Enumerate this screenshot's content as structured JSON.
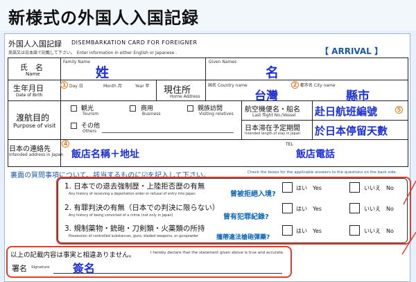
{
  "banner_title": "新様式の外国人入国記録",
  "header": {
    "card_title_ja": "外国人入国記録",
    "card_title_en": "DISEMBARKATION CARD FOR FOREIGNER",
    "instruction": "英語又は日本語で記載して下さい。　Enter information in either English or Japanese .",
    "arrival": "【 ARRIVAL 】"
  },
  "name_row": {
    "label_ja": "氏　名",
    "label_en": "Name",
    "family_label": "Family Name",
    "family_value": "姓",
    "given_label": "Given Names",
    "given_value": "名"
  },
  "dob_row": {
    "label_ja": "生年月日",
    "label_en": "Date of Birth",
    "marker": "1",
    "day": "Day 日",
    "month": "Month 月",
    "year": "Year 年",
    "address_ja": "現住所",
    "address_en": "Home Address",
    "country_label": "国名 Country name",
    "country_value": "台灣",
    "city_marker": "2",
    "city_label": "都市名 City name",
    "city_value": "縣市"
  },
  "purpose_row": {
    "label_ja": "渡航目的",
    "label_en": "Purpose of visit",
    "opt_tourism_ja": "観光",
    "opt_tourism_en": "Tourism",
    "opt_business_ja": "商用",
    "opt_business_en": "Business",
    "opt_visiting_ja": "親族訪問",
    "opt_visiting_en": "Visiting relatives",
    "opt_others_ja": "その他",
    "opt_others_en": "Others",
    "flight_label_ja": "航空機便名・船名",
    "flight_label_en": "Last flight No./Vessel",
    "flight_value": "赴日航班編號",
    "flight_marker": "5",
    "stay_label_ja": "日本滞在予定期間",
    "stay_label_en": "Intended length of stay in Japan",
    "stay_value": "於日本停留天數"
  },
  "contact_row": {
    "label_ja": "日本の連絡先",
    "label_en": "Intended address in Japan",
    "marker": "4",
    "hotel_value": "飯店名稱＋地址",
    "tel_label": "TEL",
    "tel_value": "飯店電話"
  },
  "questions_header": {
    "ja": "裏面の質問事項について、該当するものに☑を記入して下さい。",
    "en": "Check the boxes for the applicable answers to the questions on the back side."
  },
  "questions": [
    {
      "text_ja": "1. 日本での退去強制歴・上陸拒否歴の有無",
      "text_en": "Any history of receiving a deportation order or refusal of entry into Japan",
      "note": "曾被拒絕入境?",
      "yes": "はい　Yes",
      "no": "いいえ　No"
    },
    {
      "text_ja": "2. 有罪判決の有無（日本での判決に限らない）",
      "text_en": "Any history of being convicted of a crime (not only in Japan)",
      "note": "曾有犯罪紀錄?",
      "yes": "はい　Yes",
      "no": "いいえ　No"
    },
    {
      "text_ja": "3. 規制薬物・銃砲・刀剣類・火薬類の所持",
      "text_en": "Possession of controlled substances, guns, bladed weapons, or gunpowder",
      "note": "攜帶違法槍砲彈藥?",
      "yes": "はい　Yes",
      "no": "いいえ　No"
    }
  ],
  "declaration": {
    "ja": "以上の記載内容は事実と相違ありません。",
    "en": "I hereby declare that the statement given above is true and accurate.",
    "sig_ja": "署名",
    "sig_en": "Signature",
    "sig_value": "簽名"
  },
  "colors": {
    "annotation": "#1b2fd6",
    "highlight": "#e53a2a",
    "marker": "#e07a20"
  }
}
